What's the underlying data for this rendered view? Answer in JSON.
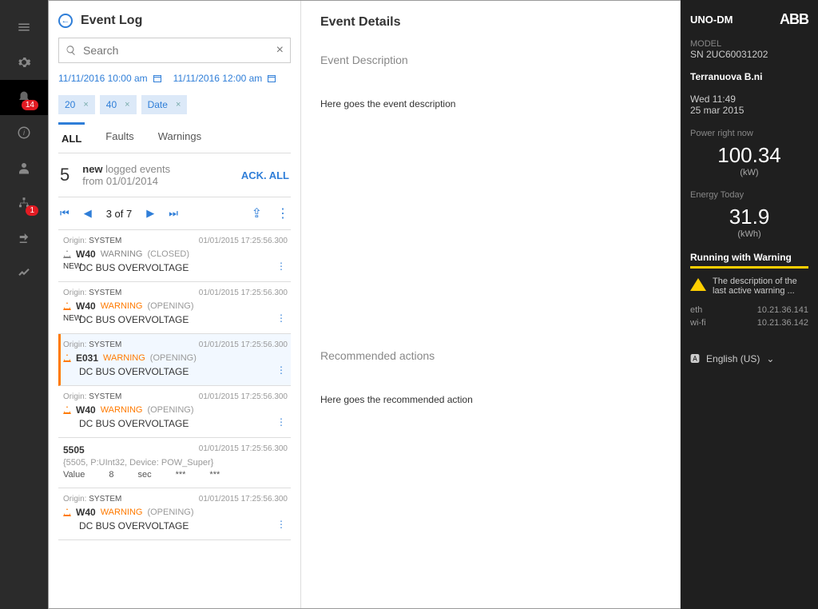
{
  "rail": {
    "notif_badge": "14",
    "net_badge": "1"
  },
  "log": {
    "title": "Event Log",
    "search_placeholder": "Search",
    "date_from": "11/11/2016 10:00 am",
    "date_to": "11/11/2016 12:00 am",
    "chips": [
      "20",
      "40",
      "Date"
    ],
    "tabs": {
      "all": "ALL",
      "faults": "Faults",
      "warnings": "Warnings"
    },
    "count": "5",
    "count_label_new": "new",
    "count_label_rest": "logged events",
    "since": "from 01/01/2014",
    "ack": "ACK. ALL",
    "pager": "3 of 7"
  },
  "events": [
    {
      "origin": "SYSTEM",
      "ts": "01/01/2015 17:25:56.300",
      "code": "W40",
      "type": "WARNING",
      "type_orange": false,
      "state": "(CLOSED)",
      "desc": "DC BUS OVERVOLTAGE",
      "new": true,
      "tri": "hollow",
      "selected": false
    },
    {
      "origin": "SYSTEM",
      "ts": "01/01/2015 17:25:56.300",
      "code": "W40",
      "type": "WARNING",
      "type_orange": true,
      "state": "(OPENING)",
      "desc": "DC BUS OVERVOLTAGE",
      "new": true,
      "tri": "orange",
      "selected": false
    },
    {
      "origin": "SYSTEM",
      "ts": "01/01/2015 17:25:56.300",
      "code": "E031",
      "type": "WARNING",
      "type_orange": true,
      "state": "(OPENING)",
      "desc": "DC BUS OVERVOLTAGE",
      "new": false,
      "tri": "orange",
      "selected": true
    },
    {
      "origin": "SYSTEM",
      "ts": "01/01/2015 17:25:56.300",
      "code": "W40",
      "type": "WARNING",
      "type_orange": true,
      "state": "(OPENING)",
      "desc": "DC BUS OVERVOLTAGE",
      "new": false,
      "tri": "orange",
      "selected": false
    }
  ],
  "data_event": {
    "id": "5505",
    "ts": "01/01/2015 17:25:56.300",
    "meta": "{5505, P:UInt32, Device: POW_Super}",
    "c1": "Value",
    "c2": "8",
    "c3": "sec",
    "c4": "***",
    "c5": "***"
  },
  "event_tail": {
    "origin": "SYSTEM",
    "ts": "01/01/2015 17:25:56.300",
    "code": "W40",
    "type": "WARNING",
    "state": "(OPENING)",
    "desc": "DC BUS OVERVOLTAGE"
  },
  "details": {
    "title": "Event Details",
    "desc_h": "Event Description",
    "desc_b": "Here goes the event description",
    "rec_h": "Recommended actions",
    "rec_b": "Here goes the recommended action"
  },
  "panel": {
    "device": "UNO-DM",
    "logo": "ABB",
    "model_lbl": "MODEL",
    "sn": "SN 2UC60031202",
    "location": "Terranuova B.ni",
    "time": "Wed 11:49",
    "date": "25 mar 2015",
    "power_lbl": "Power right now",
    "power": "100.34",
    "power_unit": "(kW)",
    "energy_lbl": "Energy Today",
    "energy": "31.9",
    "energy_unit": "(kWh)",
    "status": "Running with Warning",
    "warn_text": "The description of the last active warning ...",
    "eth_lbl": "eth",
    "eth": "10.21.36.141",
    "wifi_lbl": "wi-fi",
    "wifi": "10.21.36.142",
    "lang": "English (US)"
  }
}
